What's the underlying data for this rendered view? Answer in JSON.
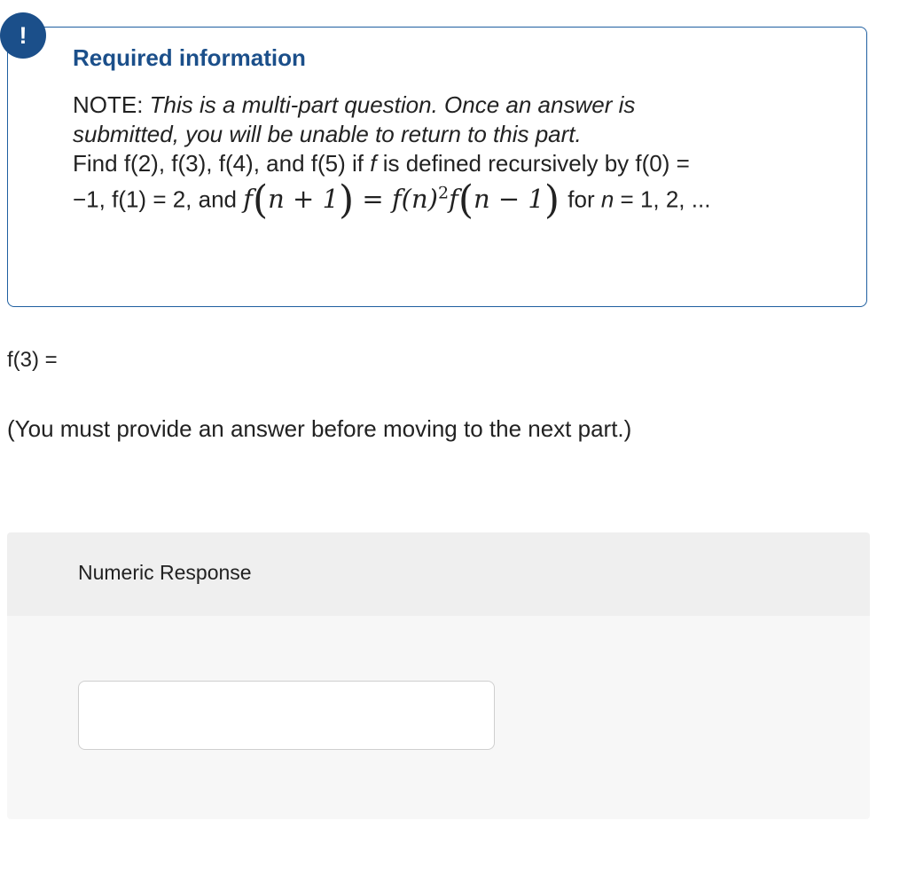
{
  "alert": {
    "icon_glyph": "!",
    "icon_name": "exclamation-icon",
    "color": "#1b4f8a"
  },
  "info": {
    "title": "Required information",
    "note_prefix": "NOTE: ",
    "note_italic_1": "This is a multi-part question. Once an answer is",
    "note_italic_2": "submitted, you will be unable to return to this part.",
    "find_prefix": "Find ",
    "f2": "f(2), ",
    "f3": "f(3), ",
    "f4": "f(4), and ",
    "f5": "f(5) if ",
    "f_var": "f",
    "defined": " is defined recursively by ",
    "f0": "f(0) =",
    "init": "−1, f(1) = 2, and",
    "math_lhs_f": "f",
    "math_lhs_arg": "n + 1",
    "math_eq": " = ",
    "math_rhs_fn": "f(n)",
    "math_exp": "2",
    "math_rhs_f": "f",
    "math_rhs_arg": "n − 1",
    "for_text": " for ",
    "n_var": "n",
    "n_values": " = 1, 2, ..."
  },
  "question": {
    "label": "f(3) =",
    "must_text": "(You must provide an answer before moving to the next part.)"
  },
  "response": {
    "header": "Numeric Response",
    "value": "",
    "placeholder": ""
  }
}
